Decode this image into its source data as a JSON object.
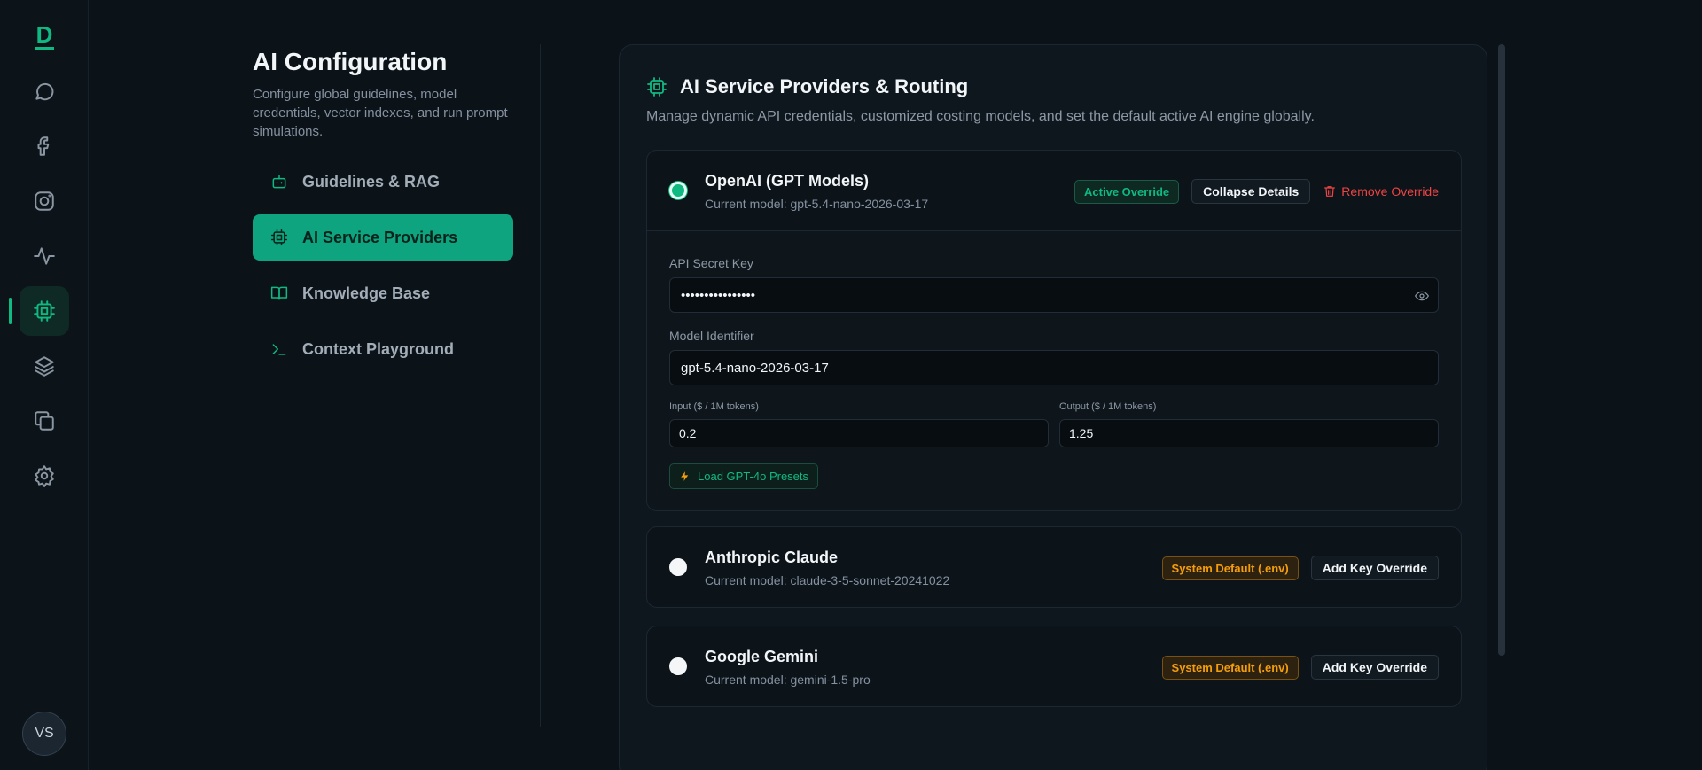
{
  "rail": {
    "logo": "D",
    "items": [
      {
        "name": "chat"
      },
      {
        "name": "facebook"
      },
      {
        "name": "instagram"
      },
      {
        "name": "activity"
      },
      {
        "name": "ai-chip"
      },
      {
        "name": "layers"
      },
      {
        "name": "copy"
      },
      {
        "name": "settings"
      }
    ],
    "avatar_initials": "VS"
  },
  "settings": {
    "title": "AI Configuration",
    "description": "Configure global guidelines, model credentials, vector indexes, and run prompt simulations.",
    "nav": [
      {
        "label": "Guidelines & RAG",
        "icon": "bot-icon"
      },
      {
        "label": "AI Service Providers",
        "icon": "chip-icon",
        "active": true
      },
      {
        "label": "Knowledge Base",
        "icon": "book-icon"
      },
      {
        "label": "Context Playground",
        "icon": "terminal-icon"
      }
    ]
  },
  "panel": {
    "title": "AI Service Providers & Routing",
    "description": "Manage dynamic API credentials, customized costing models, and set the default active AI engine globally.",
    "providers": [
      {
        "name": "OpenAI (GPT Models)",
        "model": "Current model: gpt-5.4-nano-2026-03-17",
        "badge": "Active Override",
        "collapse_label": "Collapse Details",
        "remove_label": "Remove Override",
        "details": {
          "api_key_label": "API Secret Key",
          "api_key_value": "••••••••••••••••",
          "model_label": "Model Identifier",
          "model_value": "gpt-5.4-nano-2026-03-17",
          "input_label": "Input ($ / 1M tokens)",
          "input_value": "0.2",
          "output_label": "Output ($ / 1M tokens)",
          "output_value": "1.25",
          "preset_label": "Load GPT-4o Presets"
        }
      },
      {
        "name": "Anthropic Claude",
        "model": "Current model: claude-3-5-sonnet-20241022",
        "badge": "System Default (.env)",
        "add_label": "Add Key Override"
      },
      {
        "name": "Google Gemini",
        "model": "Current model: gemini-1.5-pro",
        "badge": "System Default (.env)",
        "add_label": "Add Key Override"
      }
    ]
  },
  "colors": {
    "accent": "#10b981",
    "warning": "#f59e0b",
    "danger": "#ef4444",
    "background": "#0b1218"
  }
}
